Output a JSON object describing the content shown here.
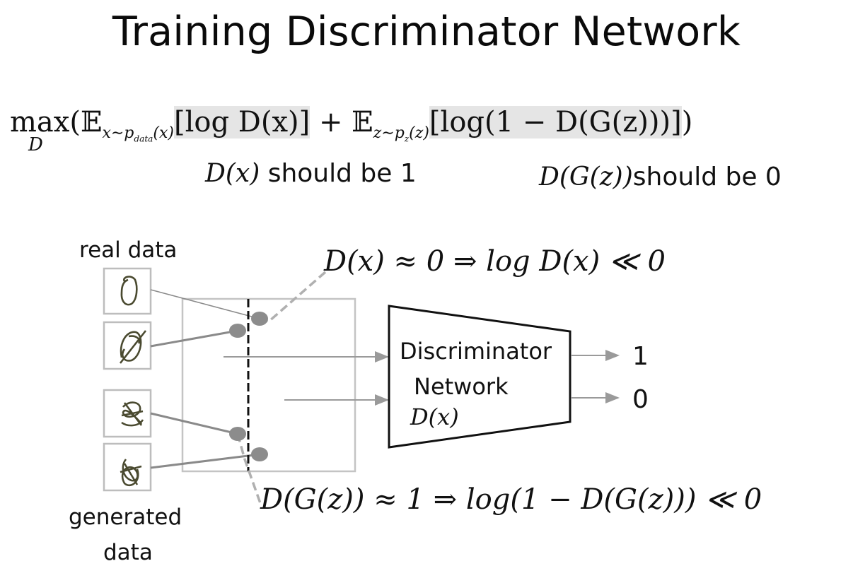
{
  "title": "Training Discriminator Network",
  "objective": {
    "max": "max",
    "max_under": "D",
    "open": "(𝔼",
    "sub1": "x∼p",
    "sub1_inner": "data",
    "sub1_close": "(x)",
    "term1": "[log D(x)]",
    "plus": " + 𝔼",
    "sub2": "z∼p",
    "sub2_inner": "z",
    "sub2_close": "(z)",
    "term2": "[log(1 − D(G(z)))]",
    "close": ")"
  },
  "notes": {
    "real_math": "D(x)",
    "real_text": " should be 1",
    "fake_math": "D(G(z))",
    "fake_text": "should be 0"
  },
  "labels": {
    "real_data": "real data",
    "generated": "generated",
    "data": "data"
  },
  "annotations": {
    "top": "D(x) ≈ 0 ⇒ log D(x) ≪ 0",
    "bottom": "D(G(z)) ≈ 1 ⇒ log(1 − D(G(z))) ≪ 0"
  },
  "network": {
    "name_line1": "Discriminator",
    "name_line2": "Network",
    "func": "D(x)"
  },
  "outputs": [
    "1",
    "0"
  ]
}
